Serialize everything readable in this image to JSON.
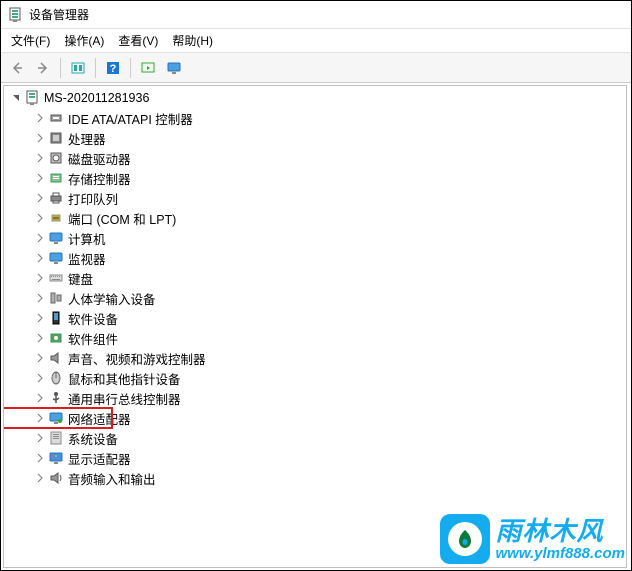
{
  "window": {
    "title": "设备管理器"
  },
  "menubar": [
    "文件(F)",
    "操作(A)",
    "查看(V)",
    "帮助(H)"
  ],
  "tree": {
    "root": "MS-202011281936",
    "children": [
      {
        "label": "IDE ATA/ATAPI 控制器",
        "icon": "controller"
      },
      {
        "label": "处理器",
        "icon": "cpu"
      },
      {
        "label": "磁盘驱动器",
        "icon": "disk"
      },
      {
        "label": "存储控制器",
        "icon": "storage"
      },
      {
        "label": "打印队列",
        "icon": "printer"
      },
      {
        "label": "端口 (COM 和 LPT)",
        "icon": "port"
      },
      {
        "label": "计算机",
        "icon": "monitor"
      },
      {
        "label": "监视器",
        "icon": "monitor"
      },
      {
        "label": "键盘",
        "icon": "keyboard"
      },
      {
        "label": "人体学输入设备",
        "icon": "hid"
      },
      {
        "label": "软件设备",
        "icon": "software"
      },
      {
        "label": "软件组件",
        "icon": "component"
      },
      {
        "label": "声音、视频和游戏控制器",
        "icon": "audio"
      },
      {
        "label": "鼠标和其他指针设备",
        "icon": "mouse"
      },
      {
        "label": "通用串行总线控制器",
        "icon": "usb"
      },
      {
        "label": "网络适配器",
        "icon": "network",
        "highlighted": true
      },
      {
        "label": "系统设备",
        "icon": "system"
      },
      {
        "label": "显示适配器",
        "icon": "display"
      },
      {
        "label": "音频输入和输出",
        "icon": "audioio"
      }
    ]
  },
  "watermark": {
    "cn": "雨林木风",
    "en": "www.ylmf888.com"
  }
}
